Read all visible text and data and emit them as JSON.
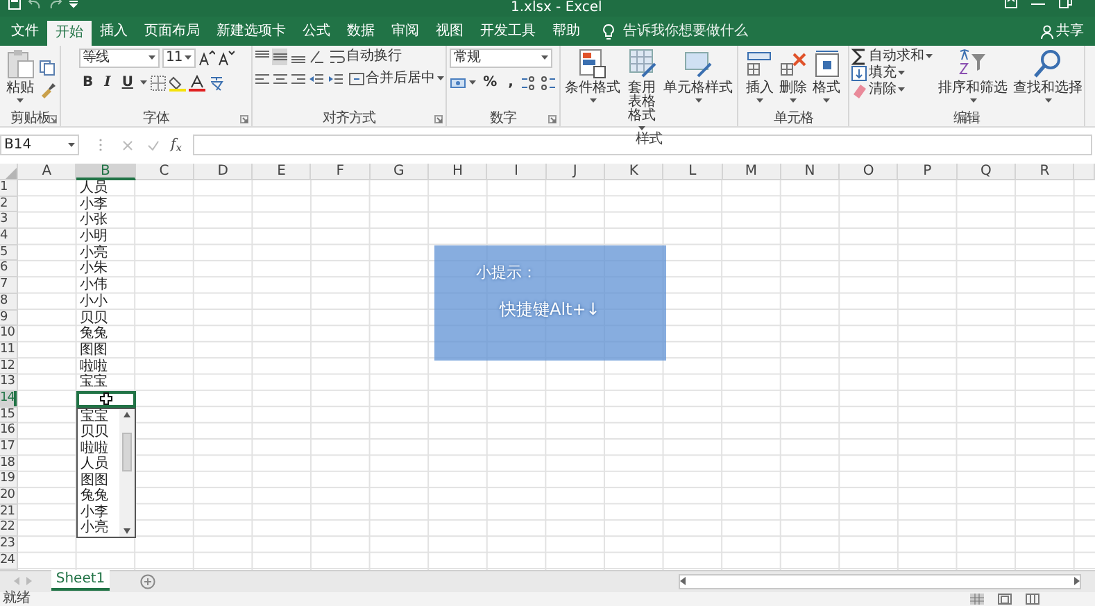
{
  "window": {
    "title": "1.xlsx - Excel"
  },
  "ribbon_tabs": [
    {
      "label": "文件",
      "selected": false
    },
    {
      "label": "开始",
      "selected": true
    },
    {
      "label": "插入",
      "selected": false
    },
    {
      "label": "页面布局",
      "selected": false
    },
    {
      "label": "新建选项卡",
      "selected": false
    },
    {
      "label": "公式",
      "selected": false
    },
    {
      "label": "数据",
      "selected": false
    },
    {
      "label": "审阅",
      "selected": false
    },
    {
      "label": "视图",
      "selected": false
    },
    {
      "label": "开发工具",
      "selected": false
    },
    {
      "label": "帮助",
      "selected": false
    }
  ],
  "tell_me": {
    "placeholder": "告诉我你想要做什么"
  },
  "share": "共享",
  "ribbon": {
    "clipboard": {
      "label": "剪贴板",
      "paste": "粘贴"
    },
    "font": {
      "label": "字体",
      "font_name": "等线",
      "font_size": "11",
      "format_buttons": [
        "B",
        "I",
        "U"
      ]
    },
    "alignment": {
      "label": "对齐方式",
      "wrap": "自动换行",
      "merge": "合并后居中"
    },
    "number": {
      "label": "数字",
      "format": "常规",
      "percent": "%",
      "comma": ","
    },
    "styles": {
      "label": "样式",
      "buttons": [
        "条件格式",
        "套用表格格式",
        "单元格样式"
      ]
    },
    "cells": {
      "label": "单元格",
      "buttons": [
        "插入",
        "删除",
        "格式"
      ]
    },
    "editing": {
      "label": "编辑",
      "small_buttons": [
        "自动求和",
        "填充",
        "清除"
      ],
      "big_buttons": [
        "排序和筛选",
        "查找和选择"
      ]
    }
  },
  "name_box": "B14",
  "formula_bar": {
    "function_button": "f$_{x}$"
  },
  "sheet": {
    "columns": [
      "A",
      "B",
      "C",
      "D",
      "E",
      "F",
      "G",
      "H",
      "I",
      "J",
      "K",
      "L",
      "M",
      "N",
      "O",
      "P",
      "Q",
      "R"
    ],
    "rows": [
      "1",
      "2",
      "3",
      "4",
      "5",
      "6",
      "7",
      "8",
      "9",
      "10",
      "11",
      "12",
      "13",
      "14",
      "15",
      "16",
      "17",
      "18",
      "19",
      "20",
      "21",
      "22",
      "23",
      "24"
    ],
    "column_b": [
      {
        "text": "人员",
        "selected": false
      },
      {
        "text": "小李",
        "selected": false
      },
      {
        "text": "小张",
        "selected": false
      },
      {
        "text": "小明",
        "selected": false
      },
      {
        "text": "小亮",
        "selected": false
      },
      {
        "text": "小朱",
        "selected": false
      },
      {
        "text": "小伟",
        "selected": false
      },
      {
        "text": "小小",
        "selected": false
      },
      {
        "text": "贝贝",
        "selected": false
      },
      {
        "text": "兔兔",
        "selected": false
      },
      {
        "text": "图图",
        "selected": false
      },
      {
        "text": "啦啦",
        "selected": false
      },
      {
        "text": "宝宝",
        "selected": false
      },
      {
        "selected": true
      }
    ]
  },
  "dropdown": {
    "items": [
      "宝宝",
      "贝贝",
      "啦啦",
      "人员",
      "图图",
      "兔兔",
      "小李",
      "小亮"
    ]
  },
  "tip": {
    "title": "小提示：",
    "text": "快捷键Alt+↓"
  },
  "sheet_tabs": [
    {
      "label": "Sheet1",
      "selected": true
    }
  ],
  "status_bar": {
    "text": "就绪"
  }
}
